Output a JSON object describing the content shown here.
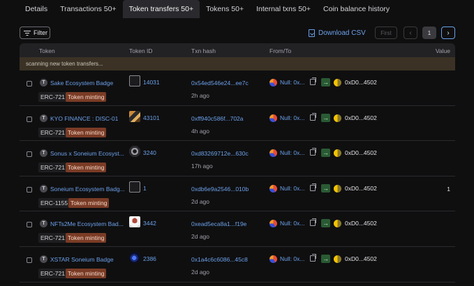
{
  "tabs": [
    {
      "label": "Details"
    },
    {
      "label": "Transactions 50+"
    },
    {
      "label": "Token transfers 50+",
      "active": true
    },
    {
      "label": "Tokens 50+"
    },
    {
      "label": "Internal txns 50+"
    },
    {
      "label": "Coin balance history"
    }
  ],
  "toolbar": {
    "filter_label": "Filter",
    "download_label": "Download CSV",
    "pagination": {
      "first_label": "First",
      "prev_symbol": "‹",
      "page": "1",
      "next_symbol": "›"
    }
  },
  "table": {
    "headers": {
      "token": "Token",
      "token_id": "Token ID",
      "txn_hash": "Txn hash",
      "from_to": "From/To",
      "value": "Value"
    },
    "notice": "scanning new token transfers...",
    "rows": [
      {
        "token_letter": "T",
        "token_name": "Sake Ecosystem Badge",
        "standard": "ERC-721",
        "method": "Token minting",
        "token_id": "14031",
        "thumb_icon": "shield-logo-icon",
        "txn_hash": "0x54ed546e24...ee7c",
        "age": "2h ago",
        "from": "Null: 0x...",
        "to": "0xD0...4502",
        "value": ""
      },
      {
        "token_letter": "T",
        "token_name": "KYO FINANCE : DISC-01",
        "standard": "ERC-721",
        "method": "Token minting",
        "token_id": "43101",
        "thumb_icon": "pixel-art-icon",
        "txn_hash": "0xff940c586f...702a",
        "age": "4h ago",
        "from": "Null: 0x...",
        "to": "0xD0...4502",
        "value": ""
      },
      {
        "token_letter": "T",
        "token_name": "Sonus x Soneium Ecosyst...",
        "standard": "ERC-721",
        "method": "Token minting",
        "token_id": "3240",
        "thumb_icon": "disc-icon",
        "txn_hash": "0xd83269712e...630c",
        "age": "17h ago",
        "from": "Null: 0x...",
        "to": "0xD0...4502",
        "value": ""
      },
      {
        "token_letter": "T",
        "token_name": "Soneium Ecosystem Badg...",
        "standard": "ERC-1155",
        "method": "Token minting",
        "token_id": "1",
        "thumb_icon": "shield-logo-icon",
        "txn_hash": "0xdb6e9a2546...010b",
        "age": "2d ago",
        "from": "Null: 0x...",
        "to": "0xD0...4502",
        "value": "1"
      },
      {
        "token_letter": "T",
        "token_name": "NFTs2Me Ecosystem Bad...",
        "standard": "ERC-721",
        "method": "Token minting",
        "token_id": "3442",
        "thumb_icon": "avatar-badge-icon",
        "txn_hash": "0xead5eca8a1...f19e",
        "age": "2d ago",
        "from": "Null: 0x...",
        "to": "0xD0...4502",
        "value": ""
      },
      {
        "token_letter": "T",
        "token_name": "XSTAR Soneium Badge",
        "standard": "ERC-721",
        "method": "Token minting",
        "token_id": "2386",
        "thumb_icon": "planet-icon",
        "txn_hash": "0x1a4c6c6086...45c8",
        "age": "2d ago",
        "from": "Null: 0x...",
        "to": "0xD0...4502",
        "value": ""
      }
    ]
  },
  "colors": {
    "link": "#6ca0e8",
    "badge_bg": "#7a3b25",
    "notice_bg": "#3b3225",
    "direction_in": "#2a5a34"
  }
}
